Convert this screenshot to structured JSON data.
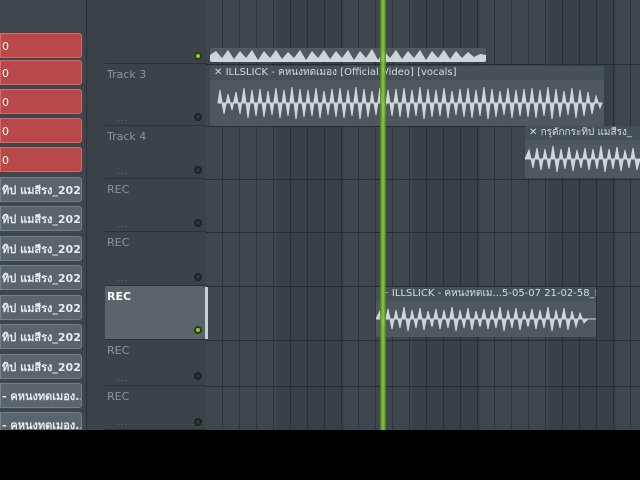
{
  "browser": {
    "clips": [
      {
        "label": "0",
        "type": "red"
      },
      {
        "label": "0",
        "type": "red"
      },
      {
        "label": "0",
        "type": "red"
      },
      {
        "label": "0",
        "type": "red"
      },
      {
        "label": "ทิป แมสีรง_202...",
        "type": "gray"
      },
      {
        "label": "ทิป แมสีรง_202...",
        "type": "gray"
      },
      {
        "label": "ทิป แมสีรง_202...",
        "type": "gray"
      },
      {
        "label": "ทิป แมสีรง_202...",
        "type": "gray"
      },
      {
        "label": "ทิป แมสีรง_202...",
        "type": "gray"
      },
      {
        "label": "ทิป แมสีรง_202...",
        "type": "gray"
      },
      {
        "label": "ทิป แมสีรง_202...",
        "type": "gray"
      },
      {
        "label": "- คหนงทดเมอง...",
        "type": "gray"
      },
      {
        "label": "- คหนงทดเมอง...",
        "type": "gray"
      }
    ]
  },
  "tracks": [
    {
      "name": "",
      "dots": "...",
      "active": true
    },
    {
      "name": "Track 3",
      "dots": "...",
      "active": false
    },
    {
      "name": "Track 4",
      "dots": "...",
      "active": false
    },
    {
      "name": "REC",
      "dots": "...",
      "active": false
    },
    {
      "name": "REC",
      "dots": "...",
      "active": false
    },
    {
      "name": "REC",
      "dots": "...",
      "active": true,
      "selected": true
    },
    {
      "name": "REC",
      "dots": "...",
      "active": false
    },
    {
      "name": "REC",
      "dots": "...",
      "active": false
    }
  ],
  "playlist_clips": {
    "track3": "ILLSLICK - คหนงทดเมอง [Official Video] [vocals]",
    "track4": "กรุดักกระทิป แมสีรง_",
    "rec": "ILLSLICK - คหนงทดเม...5-05-07 21-02-58_REC"
  },
  "colors": {
    "accent_green": "#8fd93a",
    "clip_red": "#b8484a",
    "clip_gray": "#5a646a",
    "waveform": "#cfd6da"
  }
}
